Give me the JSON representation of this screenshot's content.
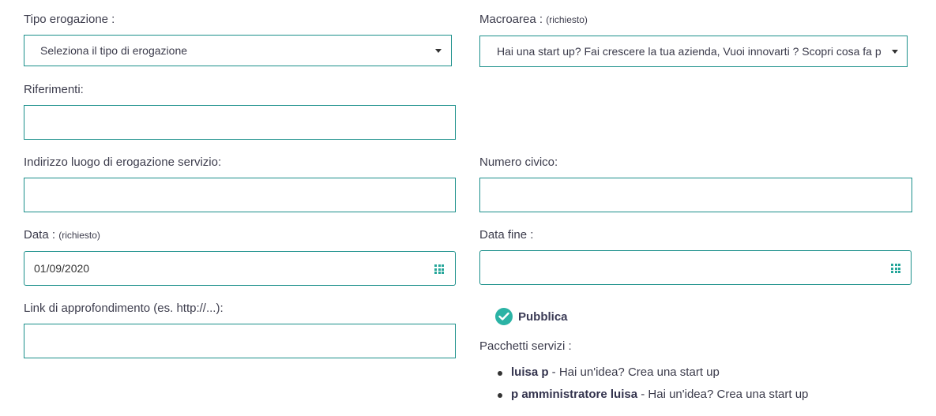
{
  "tipo_erogazione": {
    "label": "Tipo erogazione :",
    "selected": "Seleziona il tipo di erogazione"
  },
  "macroarea": {
    "label": "Macroarea :",
    "required": "(richiesto)",
    "selected": "Hai una start up? Fai crescere la tua azienda, Vuoi innovarti ? Scopri cosa fa p"
  },
  "riferimenti": {
    "label": "Riferimenti:",
    "value": ""
  },
  "indirizzo": {
    "label": "Indirizzo luogo di erogazione servizio:",
    "value": ""
  },
  "numero_civico": {
    "label": "Numero civico:",
    "value": ""
  },
  "data": {
    "label": "Data :",
    "required": "(richiesto)",
    "value": "01/09/2020",
    "icon": "calendar-grid-icon"
  },
  "data_fine": {
    "label": "Data fine :",
    "value": "",
    "icon": "calendar-grid-icon"
  },
  "link": {
    "label": "Link di approfondimento (es. http://...):",
    "value": ""
  },
  "pubblica": {
    "label": "Pubblica",
    "checked": true,
    "icon": "check-circle-icon",
    "color": "#2bb3a5"
  },
  "pacchetti": {
    "label": "Pacchetti servizi :",
    "items": [
      {
        "name": "luisa p",
        "desc": " - Hai un'idea? Crea una start up"
      },
      {
        "name": "p amministratore luisa",
        "desc": " - Hai un'idea? Crea una start up"
      }
    ]
  },
  "colors": {
    "border": "#1a8f8a",
    "accent": "#26a69a"
  }
}
